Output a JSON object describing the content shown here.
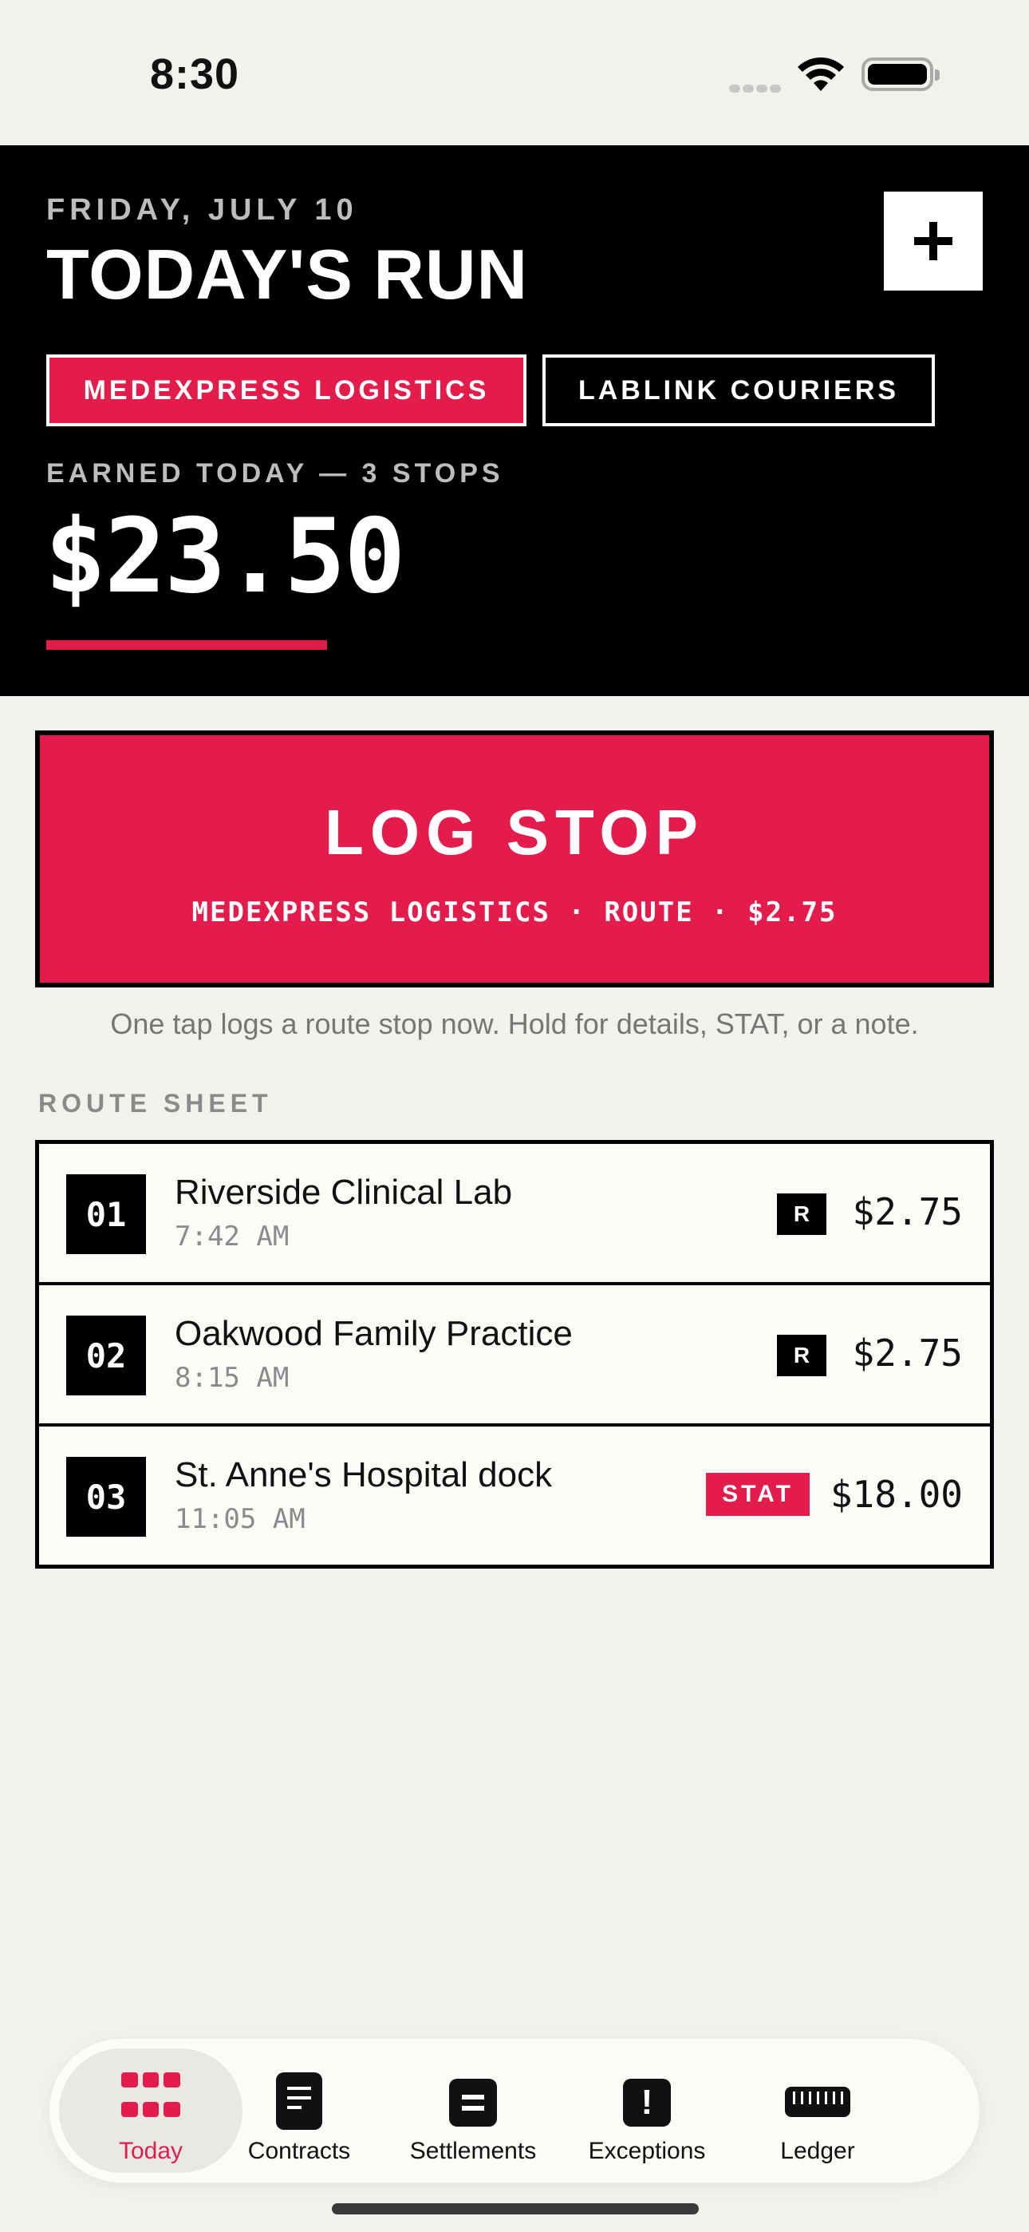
{
  "status_bar": {
    "time": "8:30"
  },
  "header": {
    "date": "FRIDAY, JULY 10",
    "title": "TODAY'S RUN",
    "add_label": "+",
    "tabs": [
      {
        "label": "MEDEXPRESS LOGISTICS",
        "active": true
      },
      {
        "label": "LABLINK COURIERS",
        "active": false
      }
    ],
    "earned_label": "EARNED TODAY — 3 STOPS",
    "earned_amount": "$23.50"
  },
  "log_stop": {
    "title": "LOG STOP",
    "subtitle": "MEDEXPRESS LOGISTICS · ROUTE · $2.75"
  },
  "hint": "One tap logs a route stop now. Hold for details, STAT, or a note.",
  "route_sheet": {
    "label": "ROUTE SHEET",
    "rows": [
      {
        "num": "01",
        "name": "Riverside Clinical Lab",
        "time": "7:42 AM",
        "badge": "R",
        "amount": "$2.75"
      },
      {
        "num": "02",
        "name": "Oakwood Family Practice",
        "time": "8:15 AM",
        "badge": "R",
        "amount": "$2.75"
      },
      {
        "num": "03",
        "name": "St. Anne's Hospital dock",
        "time": "11:05 AM",
        "badge": "STAT",
        "amount": "$18.00"
      }
    ]
  },
  "nav": {
    "items": [
      {
        "label": "Today",
        "icon": "grid-icon",
        "active": true
      },
      {
        "label": "Contracts",
        "icon": "document-icon",
        "active": false
      },
      {
        "label": "Settlements",
        "icon": "equals-icon",
        "active": false
      },
      {
        "label": "Exceptions",
        "icon": "exclamation-icon",
        "active": false
      },
      {
        "label": "Ledger",
        "icon": "ruler-icon",
        "active": false
      }
    ]
  },
  "colors": {
    "accent": "#e31c4b",
    "header_bg": "#000000",
    "page_bg": "#f2f1ec"
  }
}
